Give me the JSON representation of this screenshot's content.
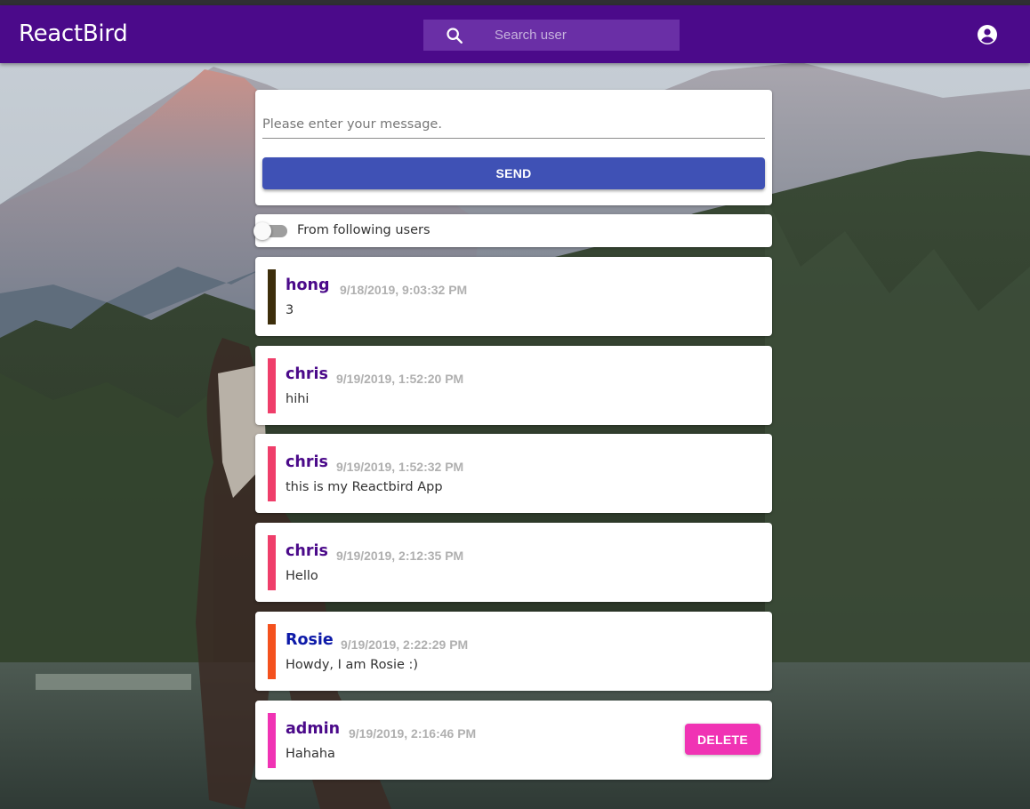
{
  "appbar": {
    "title": "ReactBird",
    "search": {
      "placeholder": "Search user",
      "value": ""
    },
    "icons": {
      "search": "search-icon",
      "account": "account-circle-icon"
    }
  },
  "composer": {
    "placeholder": "Please enter your message.",
    "value": "",
    "send_label": "SEND"
  },
  "filter": {
    "label": "From following users",
    "checked": false
  },
  "posts": [
    {
      "author": "hong",
      "time": "9/18/2019, 9:03:32 PM",
      "text": "3",
      "author_color": "#4b0a8a",
      "bar_color": "#3d2e0b"
    },
    {
      "author": "chris",
      "time": "9/19/2019, 1:52:20 PM",
      "text": "hihi",
      "author_color": "#4b0a8a",
      "bar_color": "#ef3e6a"
    },
    {
      "author": "chris",
      "time": "9/19/2019, 1:52:32 PM",
      "text": "this is my Reactbird App",
      "author_color": "#4b0a8a",
      "bar_color": "#ef3e6a"
    },
    {
      "author": "chris",
      "time": "9/19/2019, 2:12:35 PM",
      "text": "Hello",
      "author_color": "#4b0a8a",
      "bar_color": "#ef3e6a"
    },
    {
      "author": "Rosie",
      "time": "9/19/2019, 2:22:29 PM",
      "text": "Howdy, I am Rosie :)",
      "author_color": "#0d1aa8",
      "bar_color": "#f4511e"
    },
    {
      "author": "admin",
      "time": "9/19/2019, 2:16:46 PM",
      "text": "Hahaha",
      "author_color": "#4b0a8a",
      "bar_color": "#f033b4",
      "delete_label": "DELETE"
    }
  ],
  "colors": {
    "appbar": "#4b0a8a",
    "search_box": "#6a2fa6",
    "send_button": "#3f51b5",
    "delete_button": "#f033b4",
    "timestamp": "#b0b0b0"
  }
}
